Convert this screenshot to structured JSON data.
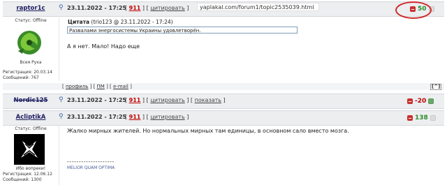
{
  "posts": [
    {
      "nick": "raptor1c",
      "date": "23.11.2022 - 17:25",
      "post_num": "911",
      "actions": [
        "цитировать"
      ],
      "status_label": "Статус:",
      "status_value": "Offline",
      "avatar_caption": "Всея Руха",
      "reg_label": "Регистрация:",
      "reg_date": "20.03.14",
      "msgs_label": "Сообщений:",
      "msgs_count": "767",
      "rating": "50",
      "quote_author": "Цитата",
      "quote_meta": " (trio123 @ 23.11.2022 - 17:24)",
      "quote_text": "Развалами энергосистемы Украины удовлетворён.",
      "text": "А я нет. Мало! Надо еще",
      "footer": [
        "профиль",
        "ПМ",
        "e-mail"
      ],
      "up_button": "[^]"
    },
    {
      "nick": "Nordic125",
      "date": "23.11.2022 - 17:25",
      "post_num": "911",
      "actions": [
        "цитировать",
        "показать"
      ],
      "rating": "-20"
    },
    {
      "nick": "AcliptikA",
      "date": "23.11.2022 - 17:25",
      "post_num": "911",
      "actions": [
        "цитировать"
      ],
      "status_label": "Статус:",
      "status_value": "Offline",
      "avatar_caption": "Ибо вопреки!",
      "reg_label": "Регистрация:",
      "reg_date": "12.06.12",
      "msgs_label": "Сообщений:",
      "msgs_count": "1300",
      "rating": "138",
      "text": "Жалко мирных жителей. Но нормальных мирных там единицы, в основном сало вместо мозга.",
      "sig_line": "--------------------",
      "signature": "MELIOR QUAM OPTIMA"
    }
  ],
  "address_bar": "yaplakal.com/forum1/topic2535039.html",
  "colors": {
    "rating_positive": "#2e8b2e",
    "rating_negative": "#c00000",
    "annotation_circle": "#d12a2a"
  }
}
